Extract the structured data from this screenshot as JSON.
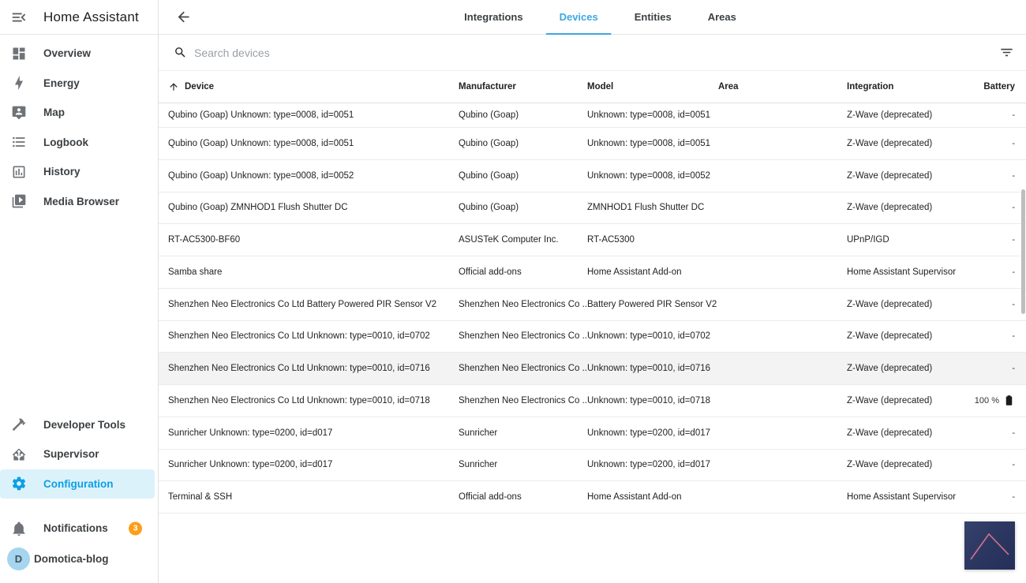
{
  "app": {
    "title": "Home Assistant"
  },
  "colors": {
    "accent_tab": "#3da8e2",
    "accent_config": "#0c9fe6",
    "badge": "#fb9e1b",
    "avatar_bg": "#a5d5ef",
    "highlighted_row": "#f3f3f3",
    "thumbnail_bg": "#2b3660",
    "thumbnail_line": "#d4718c"
  },
  "sidebar": {
    "toggle_icon": "menu-open",
    "items": [
      {
        "label": "Overview",
        "icon": "view-dashboard"
      },
      {
        "label": "Energy",
        "icon": "lightning-bolt"
      },
      {
        "label": "Map",
        "icon": "tooltip-account"
      },
      {
        "label": "Logbook",
        "icon": "format-list-bulleted"
      },
      {
        "label": "History",
        "icon": "chart-box"
      },
      {
        "label": "Media Browser",
        "icon": "play-box-multiple"
      }
    ],
    "bottom_items": [
      {
        "label": "Developer Tools",
        "icon": "hammer",
        "active": false
      },
      {
        "label": "Supervisor",
        "icon": "home-assistant",
        "active": false
      },
      {
        "label": "Configuration",
        "icon": "cog",
        "active": true
      }
    ],
    "notifications": {
      "label": "Notifications",
      "icon": "bell",
      "badge": "3"
    },
    "profile": {
      "label": "Domotica-blog",
      "avatar_letter": "D"
    }
  },
  "header": {
    "back_icon": "arrow-left",
    "tabs": [
      {
        "label": "Integrations",
        "active": false
      },
      {
        "label": "Devices",
        "active": true
      },
      {
        "label": "Entities",
        "active": false
      },
      {
        "label": "Areas",
        "active": false
      }
    ]
  },
  "search": {
    "placeholder": "Search devices",
    "icon": "magnify",
    "filter_icon": "filter-variant"
  },
  "table": {
    "sort": {
      "column": "Device",
      "direction": "asc",
      "icon": "arrow-up"
    },
    "columns": [
      "Device",
      "Manufacturer",
      "Model",
      "Area",
      "Integration",
      "Battery"
    ],
    "rows": [
      {
        "device": "Qubino (Goap) Unknown: type=0008, id=0051",
        "manufacturer": "Qubino (Goap)",
        "model": "Unknown: type=0008, id=0051",
        "area": "",
        "integration": "Z-Wave (deprecated)",
        "battery": "-",
        "clipped": true
      },
      {
        "device": "Qubino (Goap) Unknown: type=0008, id=0051",
        "manufacturer": "Qubino (Goap)",
        "model": "Unknown: type=0008, id=0051",
        "area": "",
        "integration": "Z-Wave (deprecated)",
        "battery": "-"
      },
      {
        "device": "Qubino (Goap) Unknown: type=0008, id=0052",
        "manufacturer": "Qubino (Goap)",
        "model": "Unknown: type=0008, id=0052",
        "area": "",
        "integration": "Z-Wave (deprecated)",
        "battery": "-"
      },
      {
        "device": "Qubino (Goap) ZMNHOD1 Flush Shutter DC",
        "manufacturer": "Qubino (Goap)",
        "model": "ZMNHOD1 Flush Shutter DC",
        "area": "",
        "integration": "Z-Wave (deprecated)",
        "battery": "-"
      },
      {
        "device": "RT-AC5300-BF60",
        "manufacturer": "ASUSTeK Computer Inc.",
        "model": "RT-AC5300",
        "area": "",
        "integration": "UPnP/IGD",
        "battery": "-"
      },
      {
        "device": "Samba share",
        "manufacturer": "Official add-ons",
        "model": "Home Assistant Add-on",
        "area": "",
        "integration": "Home Assistant Supervisor",
        "battery": "-"
      },
      {
        "device": "Shenzhen Neo Electronics Co Ltd Battery Powered PIR Sensor V2",
        "manufacturer": "Shenzhen Neo Electronics Co ...",
        "model": "Battery Powered PIR Sensor V2",
        "area": "",
        "integration": "Z-Wave (deprecated)",
        "battery": "-"
      },
      {
        "device": "Shenzhen Neo Electronics Co Ltd Unknown: type=0010, id=0702",
        "manufacturer": "Shenzhen Neo Electronics Co ...",
        "model": "Unknown: type=0010, id=0702",
        "area": "",
        "integration": "Z-Wave (deprecated)",
        "battery": "-"
      },
      {
        "device": "Shenzhen Neo Electronics Co Ltd Unknown: type=0010, id=0716",
        "manufacturer": "Shenzhen Neo Electronics Co ...",
        "model": "Unknown: type=0010, id=0716",
        "area": "",
        "integration": "Z-Wave (deprecated)",
        "battery": "-",
        "highlighted": true
      },
      {
        "device": "Shenzhen Neo Electronics Co Ltd Unknown: type=0010, id=0718",
        "manufacturer": "Shenzhen Neo Electronics Co ...",
        "model": "Unknown: type=0010, id=0718",
        "area": "",
        "integration": "Z-Wave (deprecated)",
        "battery": "100 %",
        "battery_icon": true
      },
      {
        "device": "Sunricher Unknown: type=0200, id=d017",
        "manufacturer": "Sunricher",
        "model": "Unknown: type=0200, id=d017",
        "area": "",
        "integration": "Z-Wave (deprecated)",
        "battery": "-"
      },
      {
        "device": "Sunricher Unknown: type=0200, id=d017",
        "manufacturer": "Sunricher",
        "model": "Unknown: type=0200, id=d017",
        "area": "",
        "integration": "Z-Wave (deprecated)",
        "battery": "-"
      },
      {
        "device": "Terminal & SSH",
        "manufacturer": "Official add-ons",
        "model": "Home Assistant Add-on",
        "area": "",
        "integration": "Home Assistant Supervisor",
        "battery": "-"
      }
    ]
  }
}
